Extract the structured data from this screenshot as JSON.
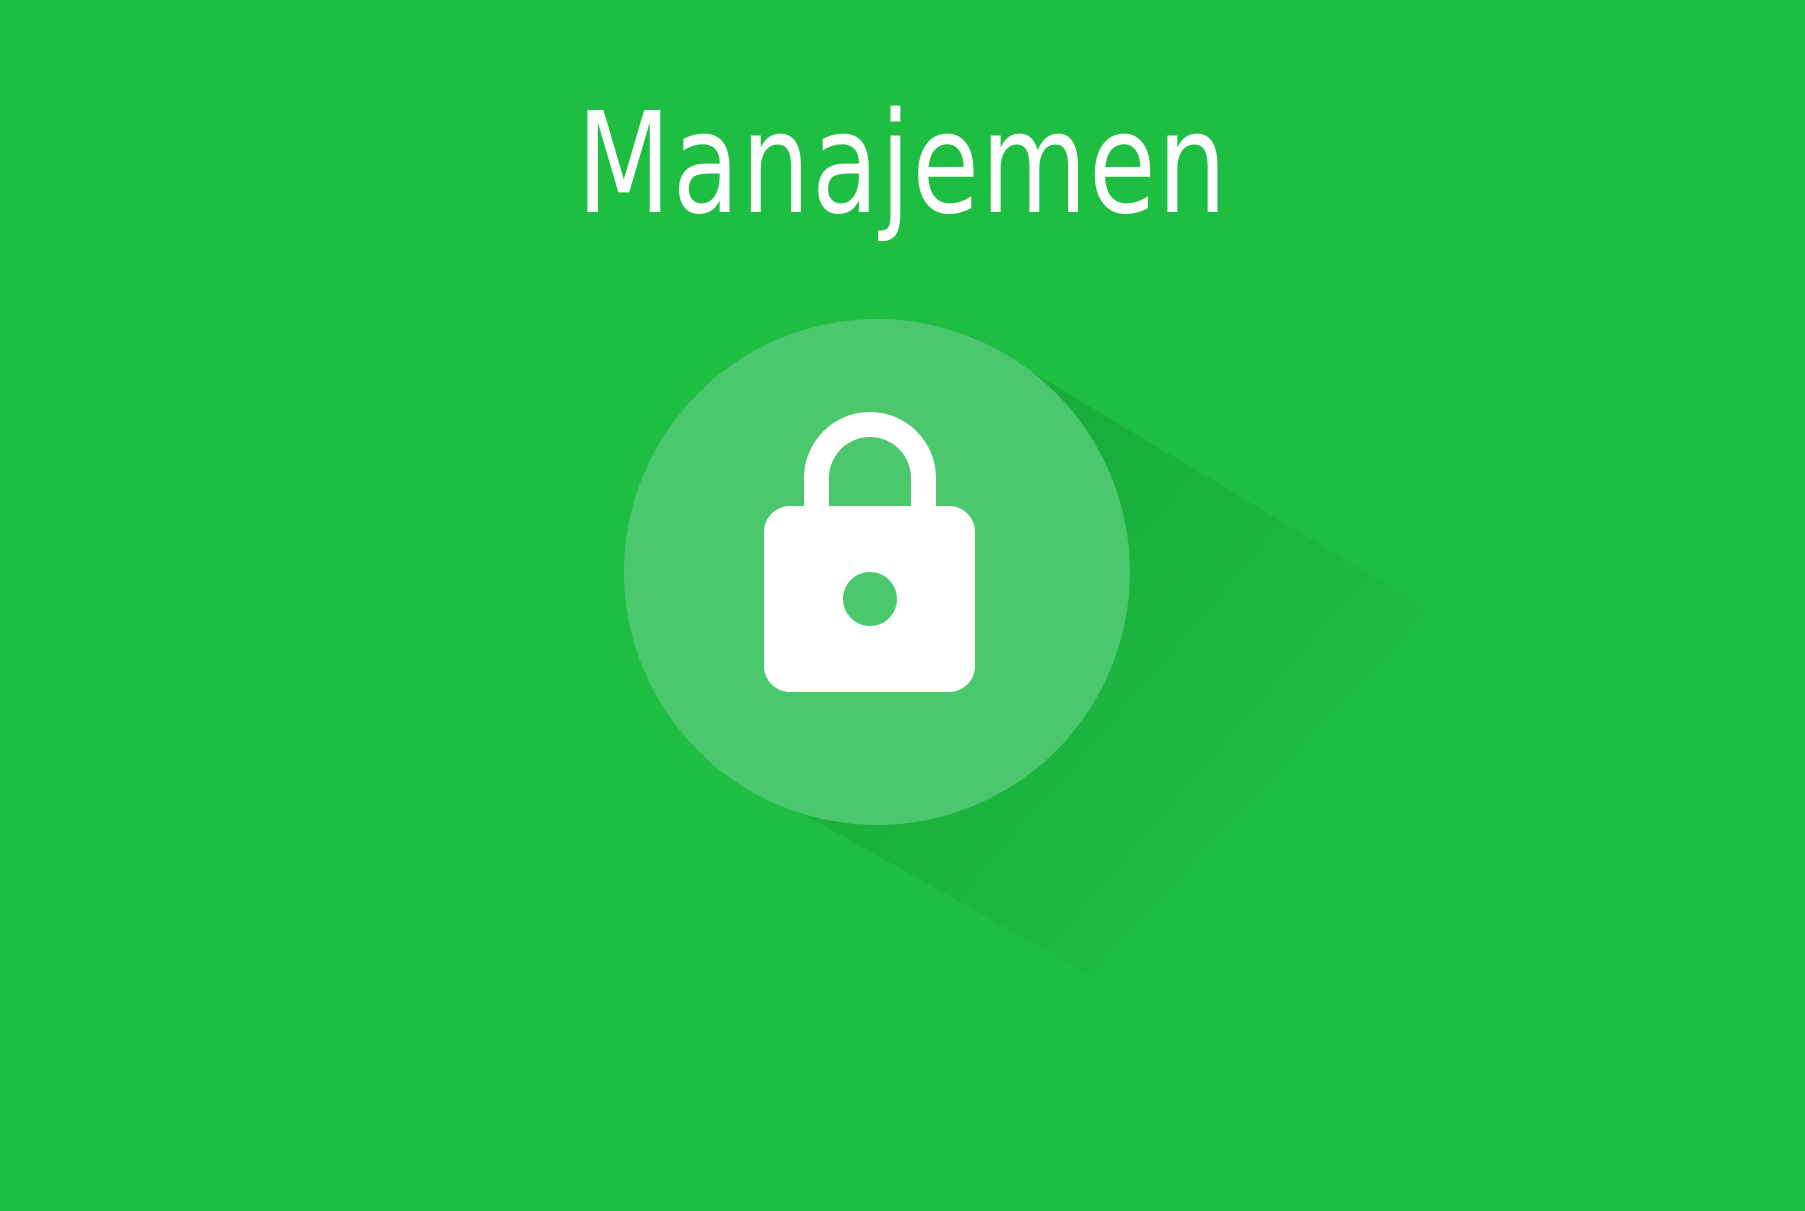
{
  "title": "Manajemen",
  "colors": {
    "background": "#1ebe42",
    "circle": "#4bc76e",
    "shadow": "#1aa93a",
    "icon": "#ffffff"
  },
  "icons": {
    "main": "lock-icon"
  }
}
